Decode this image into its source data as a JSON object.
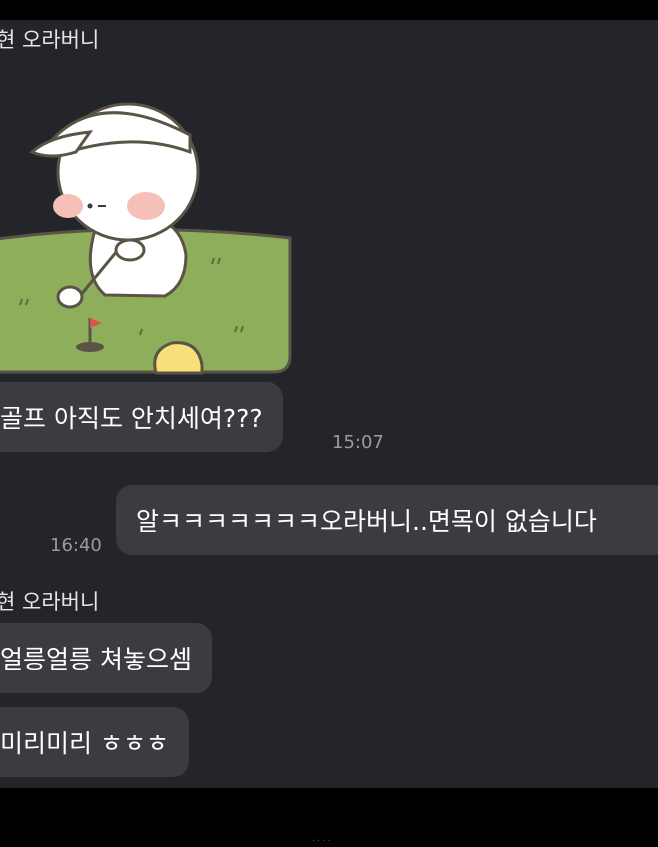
{
  "messages": [
    {
      "type": "sender",
      "name": "현 오라버니"
    },
    {
      "type": "sticker",
      "icon": "golf-character-sticker"
    },
    {
      "type": "in",
      "text": "골프 아직도 안치세여???",
      "time": "15:07"
    },
    {
      "type": "out",
      "text": "알ㅋㅋㅋㅋㅋㅋㅋ오라버니..면목이 없습니다",
      "time": "16:40"
    },
    {
      "type": "sender",
      "name": "현 오라버니"
    },
    {
      "type": "in",
      "text": "얼릉얼릉 쳐놓으셈"
    },
    {
      "type": "in",
      "text": "미리미리 ㅎㅎㅎ"
    }
  ],
  "colors": {
    "background": "#24252b",
    "bubble": "#3b3c42",
    "text": "#ffffff",
    "time": "#9a9ba2"
  }
}
